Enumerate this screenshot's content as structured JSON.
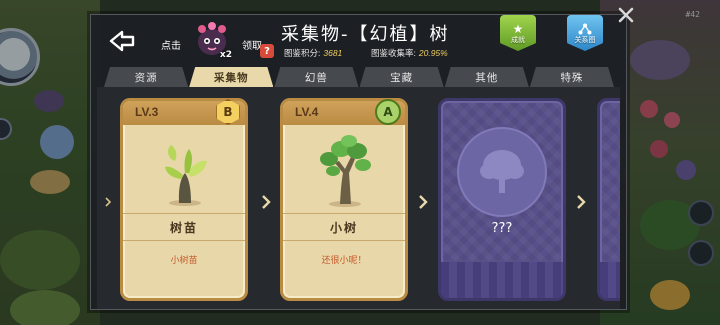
{
  "header": {
    "claim_prefix": "点击",
    "claim_suffix": "领取",
    "mascot_count": "x2",
    "title": "采集物-【幻植】树",
    "help_glyph": "?",
    "score_label": "图鉴积分:",
    "score_value": "3681",
    "rate_label": "图鉴收集率:",
    "rate_value": "20.95%",
    "achievement_label": "成就",
    "relations_label": "关系图"
  },
  "tabs": [
    {
      "label": "资源",
      "active": false
    },
    {
      "label": "采集物",
      "active": true
    },
    {
      "label": "幻兽",
      "active": false
    },
    {
      "label": "宝藏",
      "active": false
    },
    {
      "label": "其他",
      "active": false
    },
    {
      "label": "特殊",
      "active": false
    }
  ],
  "cards": [
    {
      "level": "LV.3",
      "grade": "B",
      "name": "树苗",
      "description": "小树苗",
      "locked": false
    },
    {
      "level": "LV.4",
      "grade": "A",
      "name": "小树",
      "description": "还很小呢！",
      "locked": false
    },
    {
      "name": "???",
      "locked": true
    }
  ],
  "world": {
    "map_number": "#42"
  },
  "colors": {
    "panel_bg": "#1c1f23",
    "tab_active": "#e9d8a9",
    "card_gold": "#e8d7a8",
    "card_locked": "#58508a",
    "accent_yellow": "#f0cf63",
    "achievement_green": "#7fb83a",
    "relations_blue": "#4aa3dc"
  },
  "icons": {
    "back": "back-arrow-icon",
    "close": "close-icon",
    "help": "help-icon",
    "achievement": "star-icon",
    "relations": "network-icon",
    "locked_tree": "tree-silhouette-icon",
    "next": "chevron-right-icon"
  }
}
